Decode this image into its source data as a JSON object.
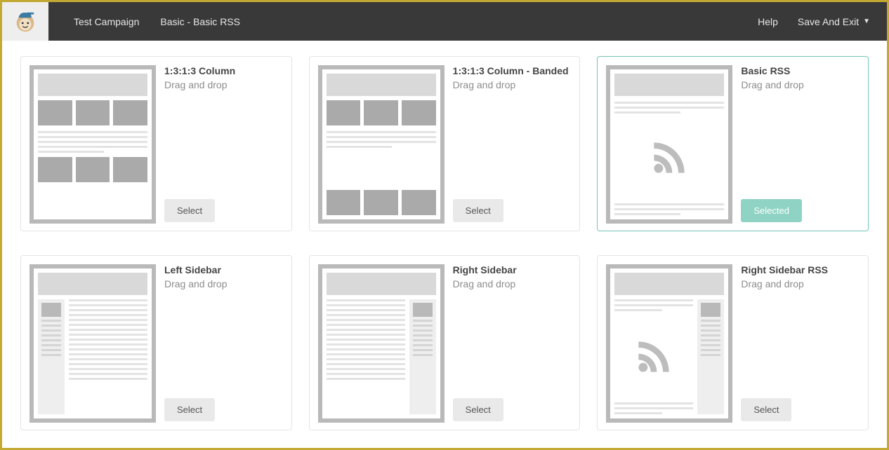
{
  "topbar": {
    "campaign": "Test Campaign",
    "template": "Basic - Basic RSS",
    "help": "Help",
    "save_exit": "Save And Exit"
  },
  "buttons": {
    "select": "Select",
    "selected": "Selected"
  },
  "templates": [
    {
      "title": "1:3:1:3 Column",
      "subtitle": "Drag and drop",
      "selected": false,
      "thumb": "col-3-1-3"
    },
    {
      "title": "1:3:1:3 Column - Banded",
      "subtitle": "Drag and drop",
      "selected": false,
      "thumb": "col-3-1-3-banded"
    },
    {
      "title": "Basic RSS",
      "subtitle": "Drag and drop",
      "selected": true,
      "thumb": "basic-rss"
    },
    {
      "title": "Left Sidebar",
      "subtitle": "Drag and drop",
      "selected": false,
      "thumb": "left-sidebar"
    },
    {
      "title": "Right Sidebar",
      "subtitle": "Drag and drop",
      "selected": false,
      "thumb": "right-sidebar"
    },
    {
      "title": "Right Sidebar RSS",
      "subtitle": "Drag and drop",
      "selected": false,
      "thumb": "right-sidebar-rss"
    }
  ]
}
